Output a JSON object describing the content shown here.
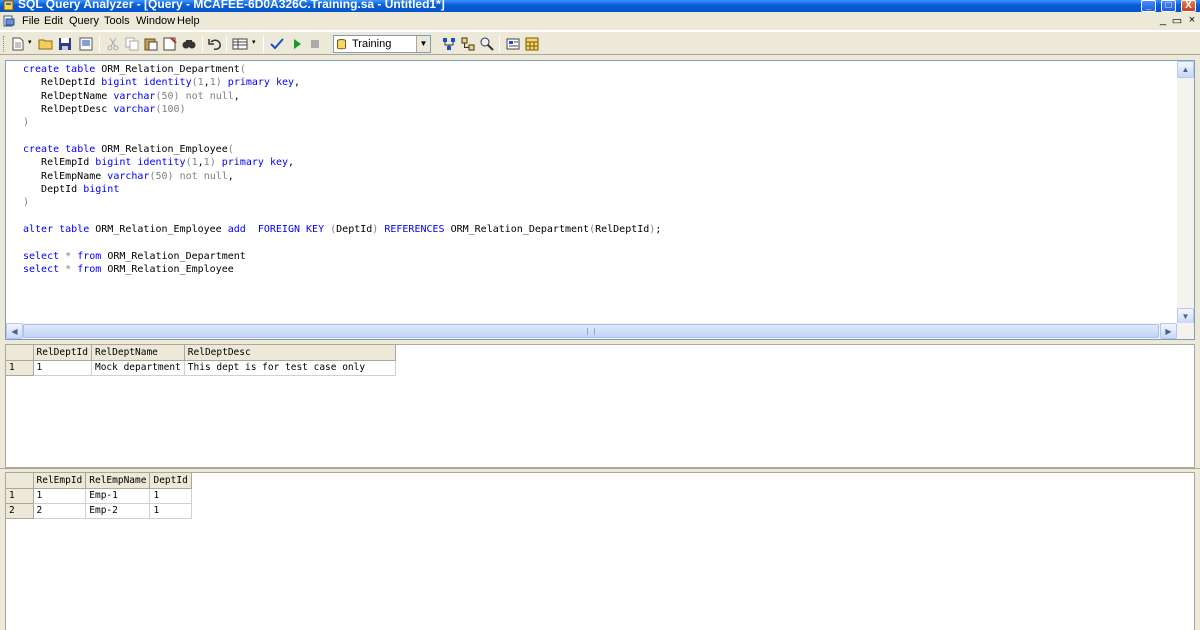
{
  "window": {
    "title": "SQL Query Analyzer - [Query - MCAFEE-6D0A326C.Training.sa - Untitled1*]",
    "minimize": "_",
    "maximize": "□",
    "close": "X",
    "mdi_minimize": "_",
    "mdi_restore": "▭",
    "mdi_close": "×"
  },
  "menu": {
    "items": [
      "File",
      "Edit",
      "Query",
      "Tools",
      "Window",
      "Help"
    ]
  },
  "toolbar": {
    "database": "Training",
    "icons": [
      "new-query-icon",
      "open-icon",
      "save-icon",
      "load-script-icon",
      "cut-icon",
      "copy-icon",
      "paste-icon",
      "clear-icon",
      "find-icon",
      "undo-icon",
      "results-mode-icon",
      "parse-icon",
      "execute-icon",
      "cancel-icon",
      "database-icon",
      "show-plan-icon",
      "object-browser-icon",
      "object-search-icon",
      "properties-icon",
      "grid-results-icon"
    ]
  },
  "editor": {
    "lines": [
      "create table ORM_Relation_Department(",
      "   RelDeptId bigint identity(1,1) primary key,",
      "   RelDeptName varchar(50) not null,",
      "   RelDeptDesc varchar(100)",
      ")",
      "",
      "create table ORM_Relation_Employee(",
      "   RelEmpId bigint identity(1,1) primary key,",
      "   RelEmpName varchar(50) not null,",
      "   DeptId bigint",
      ")",
      "",
      "alter table ORM_Relation_Employee add  FOREIGN KEY (DeptId) REFERENCES ORM_Relation_Department(RelDeptId);",
      "",
      "select * from ORM_Relation_Department",
      "select * from ORM_Relation_Employee"
    ]
  },
  "results": [
    {
      "columns": [
        "RelDeptId",
        "RelDeptName",
        "RelDeptDesc"
      ],
      "rows": [
        {
          "num": "1",
          "cells": [
            "1",
            "Mock department",
            "This dept is for test case only"
          ]
        }
      ]
    },
    {
      "columns": [
        "RelEmpId",
        "RelEmpName",
        "DeptId"
      ],
      "rows": [
        {
          "num": "1",
          "cells": [
            "1",
            "Emp-1",
            "1"
          ]
        },
        {
          "num": "2",
          "cells": [
            "2",
            "Emp-2",
            "1"
          ]
        }
      ]
    }
  ]
}
